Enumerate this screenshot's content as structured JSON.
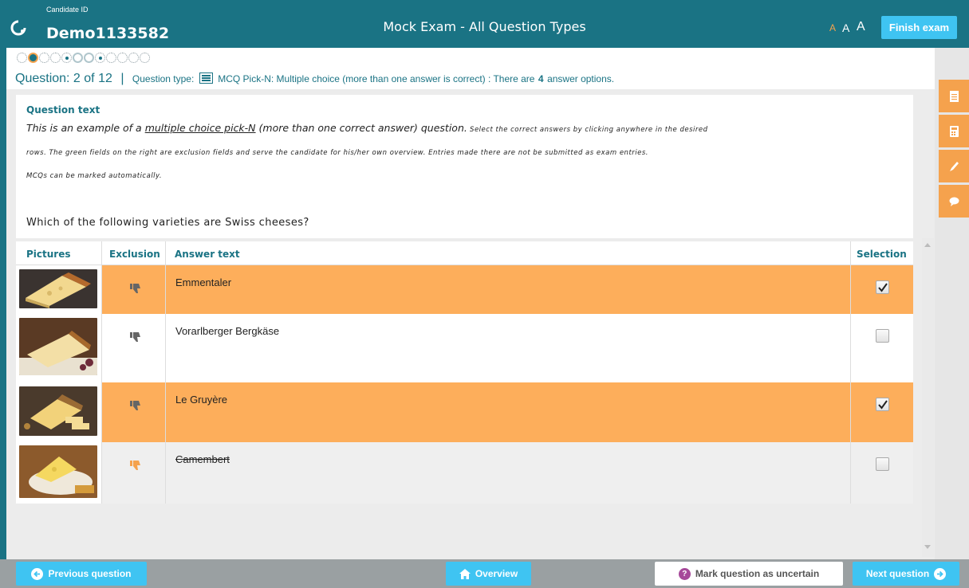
{
  "header": {
    "candidate_label": "Candidate ID",
    "candidate_id": "Demo1133582",
    "exam_title": "Mock Exam - All Question Types",
    "font_sizes": [
      "A",
      "A",
      "A"
    ],
    "finish_label": "Finish exam"
  },
  "progress": {
    "dots": [
      "unanswered",
      "current",
      "unanswered",
      "unanswered",
      "answered",
      "uncertain",
      "uncertain",
      "answered",
      "unanswered",
      "unanswered",
      "unanswered",
      "unanswered"
    ]
  },
  "question_info": {
    "number_label": "Question: 2 of 12",
    "separator": "|",
    "type_label": "Question type:",
    "type_name": "MCQ Pick-N: Multiple choice (more than one answer is correct) : There are",
    "option_count": "4",
    "option_suffix": "answer options."
  },
  "question": {
    "heading": "Question text",
    "lead_before": "This is an example of a ",
    "lead_underlined": "multiple choice pick-N",
    "lead_after": " (more than one correct answer) question.",
    "instructions_1": " Select the correct answers by clicking anywhere in the desired",
    "instructions_2": "rows. The green fields on the right are exclusion fields and serve the candidate for his/her own overview. Entries made there are not be submitted as exam entries.",
    "instructions_3": "MCQs can be marked automatically.",
    "prompt": "Which of the following varieties are Swiss cheeses?"
  },
  "table": {
    "headers": {
      "pictures": "Pictures",
      "exclusion": "Exclusion",
      "answer": "Answer text",
      "selection": "Selection"
    },
    "rows": [
      {
        "answer": "Emmentaler",
        "state": "selected",
        "checked": true,
        "image": "emmentaler-photo"
      },
      {
        "answer": "Vorarlberger Bergkäse",
        "state": "normal",
        "checked": false,
        "image": "bergkaese-photo"
      },
      {
        "answer": "Le Gruyère",
        "state": "selected",
        "checked": true,
        "image": "gruyere-photo"
      },
      {
        "answer": "Camembert",
        "state": "excluded",
        "checked": false,
        "image": "camembert-photo"
      }
    ]
  },
  "tools": [
    "notes-icon",
    "calculator-icon",
    "pen-icon",
    "comment-icon"
  ],
  "footer": {
    "previous": "Previous question",
    "overview": "Overview",
    "uncertain": "Mark question as uncertain",
    "next": "Next question"
  },
  "colors": {
    "header_bg": "#1a7384",
    "accent_orange": "#f5a24d",
    "selected_row": "#fdae5b",
    "button_blue": "#3fc4f2",
    "footer_bg": "#9aa0a2"
  }
}
